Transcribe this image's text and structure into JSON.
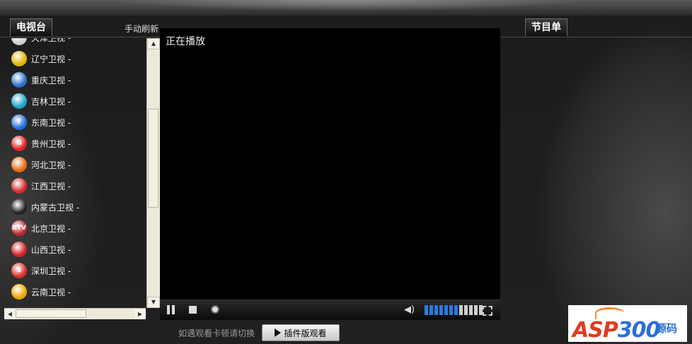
{
  "left_panel": {
    "tab_label": "电视台",
    "refresh_label": "手动刷新",
    "channels": [
      {
        "name": "天津卫视 -",
        "logo": "tianjin-logo",
        "color": "#cfcfcf",
        "text": ""
      },
      {
        "name": "辽宁卫视 -",
        "logo": "liaoning-logo",
        "color": "#e2b400",
        "text": ""
      },
      {
        "name": "重庆卫视 -",
        "logo": "chongqing-logo",
        "color": "#2d6fd1",
        "text": ""
      },
      {
        "name": "吉林卫视 -",
        "logo": "jilin-logo",
        "color": "#1aa2c8",
        "text": ""
      },
      {
        "name": "东南卫视 -",
        "logo": "dongnan-logo",
        "color": "#1f6fe0",
        "text": "f"
      },
      {
        "name": "贵州卫视 -",
        "logo": "guizhou-logo",
        "color": "#e02424",
        "text": "G"
      },
      {
        "name": "河北卫视 -",
        "logo": "hebei-logo",
        "color": "#e86a10",
        "text": ""
      },
      {
        "name": "江西卫视 -",
        "logo": "jiangxi-logo",
        "color": "#d42a2a",
        "text": ""
      },
      {
        "name": "内蒙古卫视 -",
        "logo": "neimenggu-logo",
        "color": "#222",
        "text": ""
      },
      {
        "name": "北京卫视 -",
        "logo": "beijing-logo",
        "color": "#c0282a",
        "text": "BTV"
      },
      {
        "name": "山西卫视 -",
        "logo": "shanxi-logo",
        "color": "#d12020",
        "text": ""
      },
      {
        "name": "深圳卫视 -",
        "logo": "shenzhen-logo",
        "color": "#d9302a",
        "text": "S"
      },
      {
        "name": "云南卫视 -",
        "logo": "yunnan-logo",
        "color": "#f0a400",
        "text": ""
      }
    ]
  },
  "player": {
    "status": "正在播放",
    "volume_level": 0.6,
    "volume_on_color": "#2a7ae2",
    "volume_off_color": "#cfcfcf"
  },
  "right_panel": {
    "tab_label": "节目单"
  },
  "bottom": {
    "hint": "如遇观看卡顿请切换",
    "plugin_button": "插件版观看",
    "logo_asp": "ASP",
    "logo_num": "300",
    "logo_cn": "源码"
  }
}
